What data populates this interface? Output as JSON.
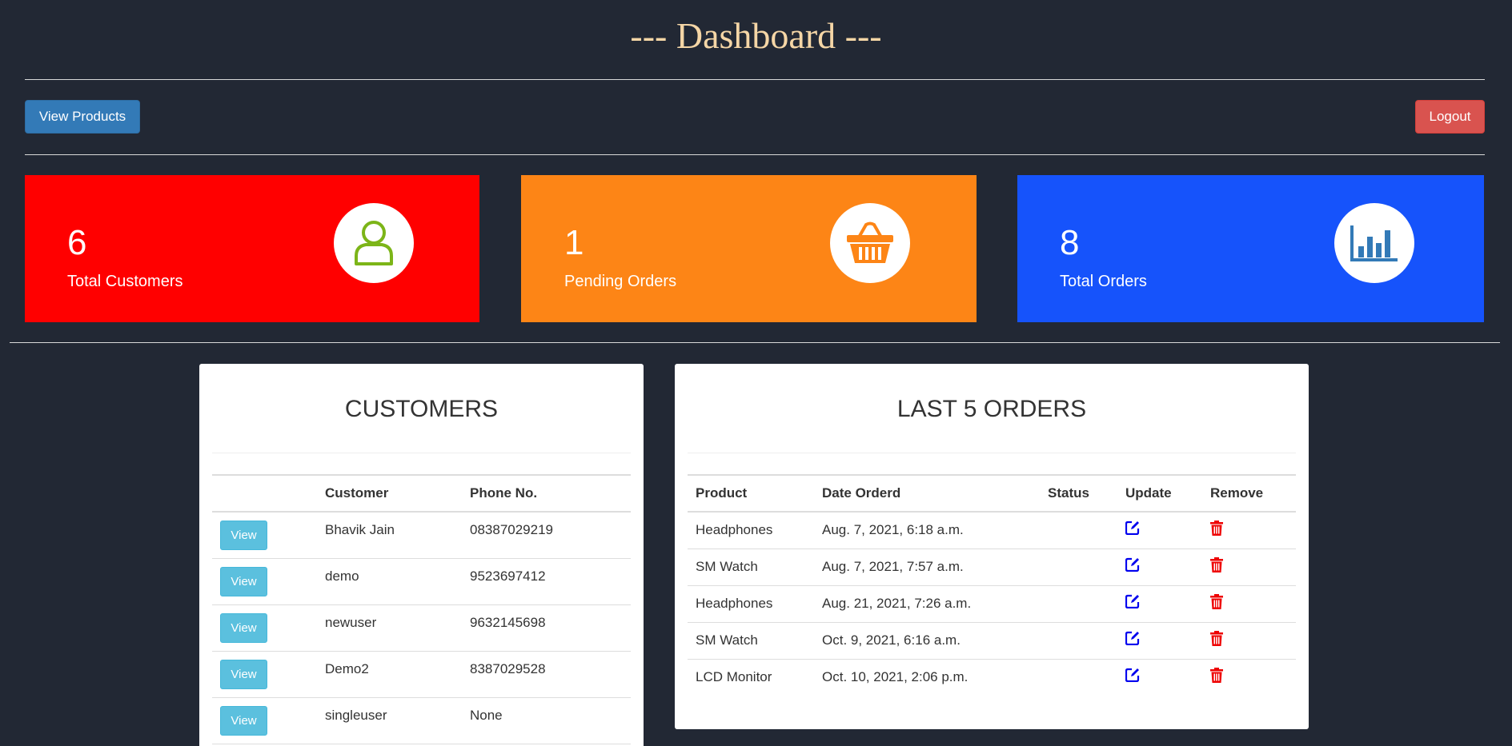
{
  "header": {
    "title": "--- Dashboard ---"
  },
  "toolbar": {
    "view_products_label": "View Products",
    "logout_label": "Logout"
  },
  "stats": [
    {
      "value": "6",
      "label": "Total Customers",
      "icon": "user-icon",
      "color": "#ff0000"
    },
    {
      "value": "1",
      "label": "Pending Orders",
      "icon": "basket-icon",
      "color": "#fd8516"
    },
    {
      "value": "8",
      "label": "Total Orders",
      "icon": "bar-chart-icon",
      "color": "#1653fb"
    }
  ],
  "customers": {
    "title": "CUSTOMERS",
    "columns": [
      "",
      "Customer",
      "Phone No."
    ],
    "view_label": "View",
    "rows": [
      {
        "name": "Bhavik Jain",
        "phone": "08387029219"
      },
      {
        "name": "demo",
        "phone": "9523697412"
      },
      {
        "name": "newuser",
        "phone": "9632145698"
      },
      {
        "name": "Demo2",
        "phone": "8387029528"
      },
      {
        "name": "singleuser",
        "phone": "None"
      }
    ]
  },
  "orders": {
    "title": "LAST 5 ORDERS",
    "columns": [
      "Product",
      "Date Orderd",
      "Status",
      "Update",
      "Remove"
    ],
    "rows": [
      {
        "product": "Headphones",
        "date": "Aug. 7, 2021, 6:18 a.m.",
        "status": ""
      },
      {
        "product": "SM Watch",
        "date": "Aug. 7, 2021, 7:57 a.m.",
        "status": ""
      },
      {
        "product": "Headphones",
        "date": "Aug. 21, 2021, 7:26 a.m.",
        "status": ""
      },
      {
        "product": "SM Watch",
        "date": "Oct. 9, 2021, 6:16 a.m.",
        "status": ""
      },
      {
        "product": "LCD Monitor",
        "date": "Oct. 10, 2021, 2:06 p.m.",
        "status": ""
      }
    ],
    "update_icon": "edit-icon",
    "remove_icon": "trash-icon",
    "update_color": "#0000ee",
    "remove_color": "#ee0000"
  }
}
